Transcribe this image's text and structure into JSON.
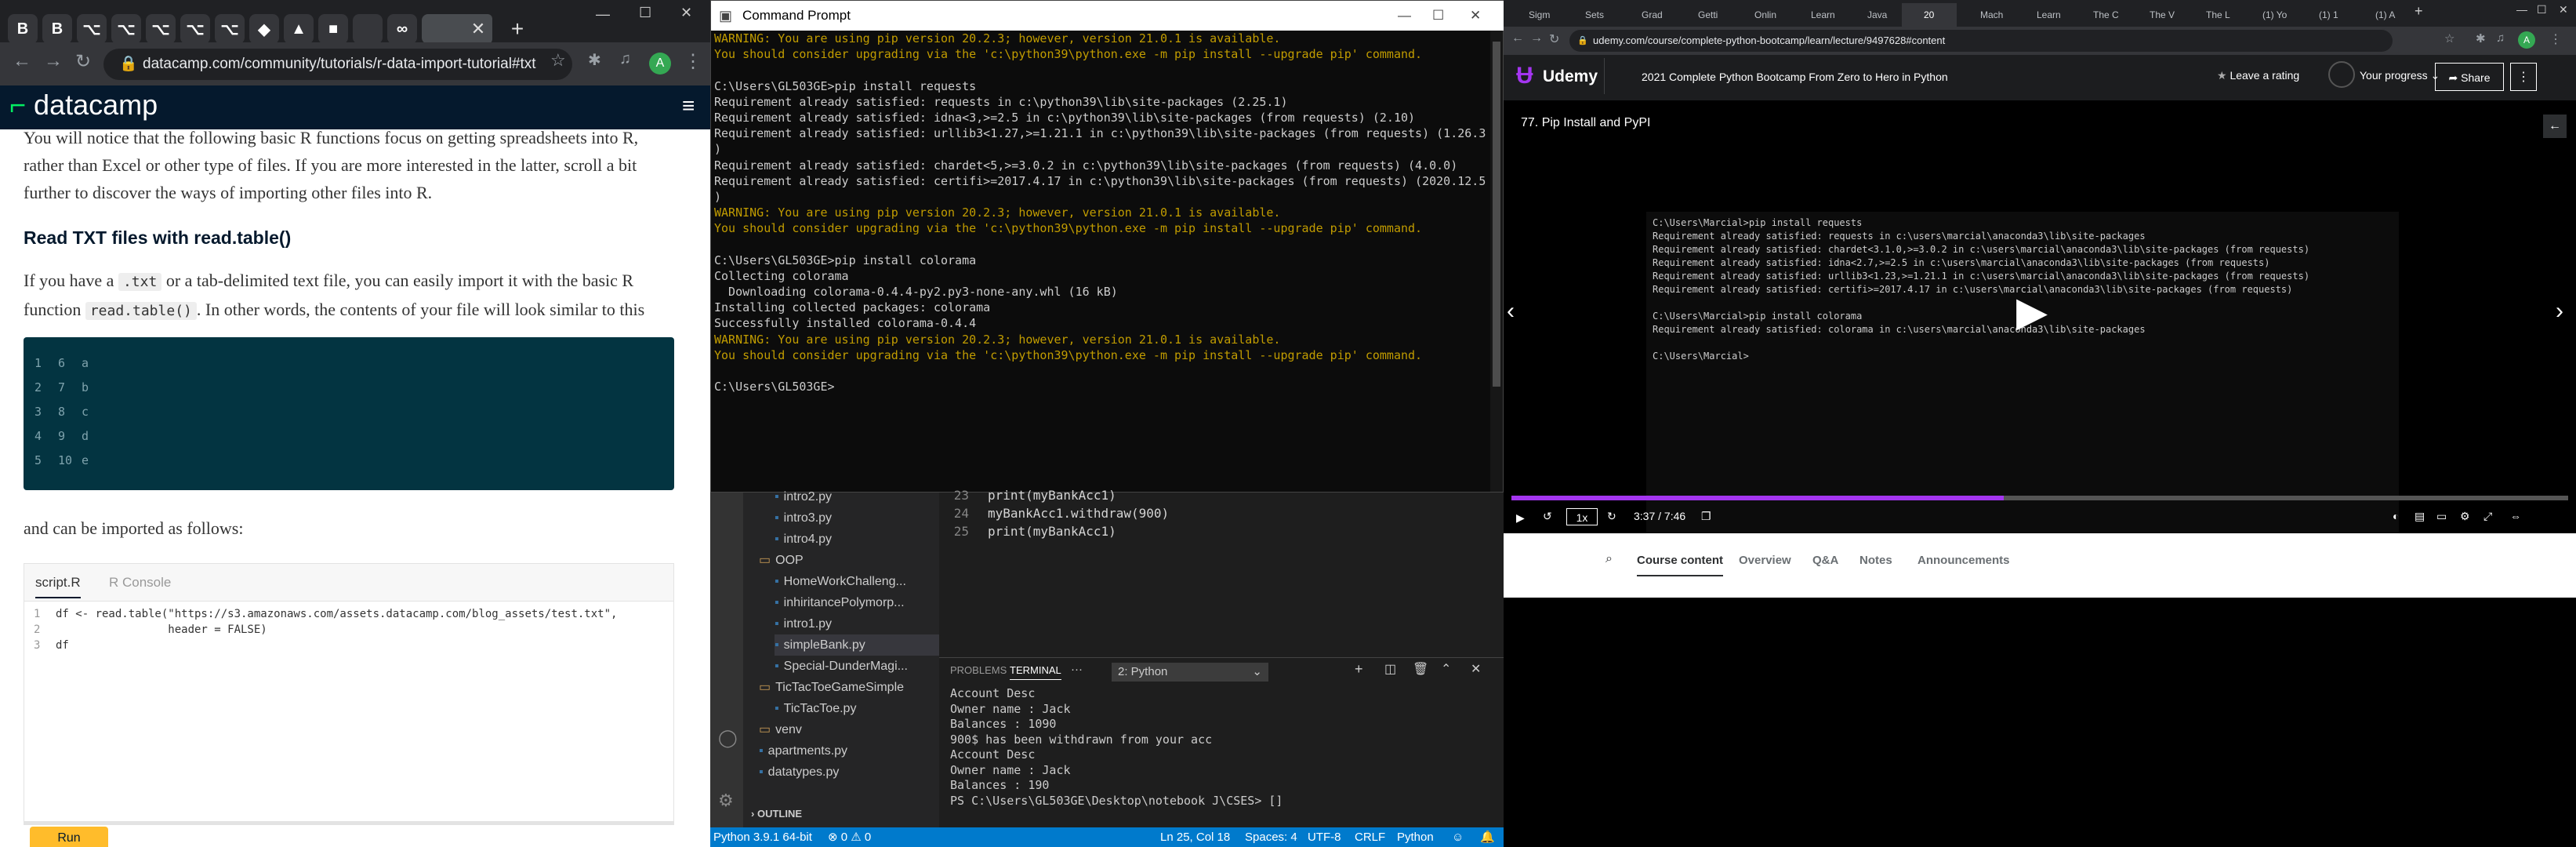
{
  "left_browser": {
    "tabs": [
      "B",
      "B",
      "⌥",
      "⌥",
      "⌥",
      "⌥",
      "⌥",
      "◆",
      "▲",
      "■",
      "",
      "∞",
      ""
    ],
    "url": "datacamp.com/community/tutorials/r-data-import-tutorial#txt",
    "brand": "datacamp",
    "intro": "You will notice that the following basic R functions focus on getting spreadsheets into R, rather than Excel or other type of files. If you are more interested in the latter, scroll a bit further to discover the ways of importing other files into R.",
    "heading": "Read TXT files with read.table()",
    "para_a": "If you have a",
    "code1": ".txt",
    "para_b": "or a tab-delimited text file, you can easily import it with the basic R function",
    "code2": "read.table()",
    "para_c": ". In other words, the contents of your file will look similar to this",
    "data_rows": [
      [
        "1",
        "6",
        "a"
      ],
      [
        "2",
        "7",
        "b"
      ],
      [
        "3",
        "8",
        "c"
      ],
      [
        "4",
        "9",
        "d"
      ],
      [
        "5",
        "10",
        "e"
      ]
    ],
    "import_text": "and can be imported as follows:",
    "editor_tabs": [
      "script.R",
      "R Console"
    ],
    "editor_lines": [
      {
        "n": "1",
        "text": "df <- read.table(\"https://s3.amazonaws.com/assets.datacamp.com/blog_assets/test.txt\","
      },
      {
        "n": "2",
        "text": "                 header = FALSE)"
      },
      {
        "n": "3",
        "text": "df"
      }
    ],
    "run_label": "Run"
  },
  "cmd": {
    "title": "Command Prompt",
    "lines": [
      {
        "t": "w",
        "s": "WARNING: You are using pip version 20.2.3; however, version 21.0.1 is available."
      },
      {
        "t": "w",
        "s": "You should consider upgrading via the 'c:\\python39\\python.exe -m pip install --upgrade pip' command."
      },
      {
        "t": "n",
        "s": ""
      },
      {
        "t": "n",
        "s": "C:\\Users\\GL503GE>pip install requests"
      },
      {
        "t": "n",
        "s": "Requirement already satisfied: requests in c:\\python39\\lib\\site-packages (2.25.1)"
      },
      {
        "t": "n",
        "s": "Requirement already satisfied: idna<3,>=2.5 in c:\\python39\\lib\\site-packages (from requests) (2.10)"
      },
      {
        "t": "n",
        "s": "Requirement already satisfied: urllib3<1.27,>=1.21.1 in c:\\python39\\lib\\site-packages (from requests) (1.26.3"
      },
      {
        "t": "n",
        "s": ")"
      },
      {
        "t": "n",
        "s": "Requirement already satisfied: chardet<5,>=3.0.2 in c:\\python39\\lib\\site-packages (from requests) (4.0.0)"
      },
      {
        "t": "n",
        "s": "Requirement already satisfied: certifi>=2017.4.17 in c:\\python39\\lib\\site-packages (from requests) (2020.12.5"
      },
      {
        "t": "n",
        "s": ")"
      },
      {
        "t": "w",
        "s": "WARNING: You are using pip version 20.2.3; however, version 21.0.1 is available."
      },
      {
        "t": "w",
        "s": "You should consider upgrading via the 'c:\\python39\\python.exe -m pip install --upgrade pip' command."
      },
      {
        "t": "n",
        "s": ""
      },
      {
        "t": "n",
        "s": "C:\\Users\\GL503GE>pip install colorama"
      },
      {
        "t": "n",
        "s": "Collecting colorama"
      },
      {
        "t": "n",
        "s": "  Downloading colorama-0.4.4-py2.py3-none-any.whl (16 kB)"
      },
      {
        "t": "n",
        "s": "Installing collected packages: colorama"
      },
      {
        "t": "n",
        "s": "Successfully installed colorama-0.4.4"
      },
      {
        "t": "w",
        "s": "WARNING: You are using pip version 20.2.3; however, version 21.0.1 is available."
      },
      {
        "t": "w",
        "s": "You should consider upgrading via the 'c:\\python39\\python.exe -m pip install --upgrade pip' command."
      },
      {
        "t": "n",
        "s": ""
      },
      {
        "t": "n",
        "s": "C:\\Users\\GL503GE>"
      }
    ]
  },
  "vscode": {
    "files": [
      "intro2.py",
      "intro3.py",
      "intro4.py",
      "OOP",
      "HomeWorkChalleng...",
      "inhiritancePolymorp...",
      "intro1.py",
      "simpleBank.py",
      "Special-DunderMagi...",
      "TicTacToeGameSimple",
      "TicTacToe.py",
      "venv",
      "apartments.py",
      "datatypes.py"
    ],
    "outline": "OUTLINE",
    "code": [
      {
        "n": "23",
        "s": "print(myBankAcc1)"
      },
      {
        "n": "24",
        "s": "myBankAcc1.withdraw(900)"
      },
      {
        "n": "25",
        "s": "print(myBankAcc1)"
      }
    ],
    "panel_tabs": [
      "PROBLEMS",
      "TERMINAL",
      "···"
    ],
    "terminal_select": "2: Python",
    "terminal": [
      "Account Desc",
      "Owner name : Jack",
      "Balances : 1090",
      "900$ has been withdrawn from your acc",
      "Account Desc",
      "Owner name : Jack",
      "Balances : 190",
      "PS C:\\Users\\GL503GE\\Desktop\\notebook J\\CSES> []"
    ],
    "status_left": [
      "Python 3.9.1 64-bit",
      "⊗ 0 ⚠ 0"
    ],
    "status_right": [
      "Ln 25, Col 18",
      "Spaces: 4",
      "UTF-8",
      "CRLF",
      "Python"
    ]
  },
  "right_browser": {
    "tabs": [
      "Sigm",
      "Sets",
      "Grad",
      "Getti",
      "Onlin",
      "Learn",
      "Java",
      "20",
      "Mach",
      "Learn",
      "The C",
      "The V",
      "The L",
      "(1) Yo",
      "(1) 1",
      "(1) A"
    ],
    "url": "udemy.com/course/complete-python-bootcamp/learn/lecture/9497628#content",
    "brand": "Udemy",
    "course_title": "2021 Complete Python Bootcamp From Zero to Hero in Python",
    "rating": "Leave a rating",
    "progress": "Your progress",
    "share": "Share",
    "lecture": "77. Pip Install and PyPI",
    "video_term": [
      "C:\\Users\\Marcial>pip install requests",
      "Requirement already satisfied: requests in c:\\users\\marcial\\anaconda3\\lib\\site-packages",
      "Requirement already satisfied: chardet<3.1.0,>=3.0.2 in c:\\users\\marcial\\anaconda3\\lib\\site-packages (from requests)",
      "Requirement already satisfied: idna<2.7,>=2.5 in c:\\users\\marcial\\anaconda3\\lib\\site-packages (from requests)",
      "Requirement already satisfied: urllib3<1.23,>=1.21.1 in c:\\users\\marcial\\anaconda3\\lib\\site-packages (from requests)",
      "Requirement already satisfied: certifi>=2017.4.17 in c:\\users\\marcial\\anaconda3\\lib\\site-packages (from requests)",
      "",
      "C:\\Users\\Marcial>pip install colorama",
      "Requirement already satisfied: colorama in c:\\users\\marcial\\anaconda3\\lib\\site-packages",
      "",
      "C:\\Users\\Marcial>"
    ],
    "speed": "1x",
    "time": "3:37 / 7:46",
    "video_progress": 0.466,
    "content_tabs": [
      "Course content",
      "Overview",
      "Q&A",
      "Notes",
      "Announcements"
    ]
  },
  "colors": {
    "datacamp_green": "#03ef62",
    "udemy_purple": "#a435f0",
    "vscode_blue": "#007acc",
    "cmd_warning": "#c19c00"
  }
}
